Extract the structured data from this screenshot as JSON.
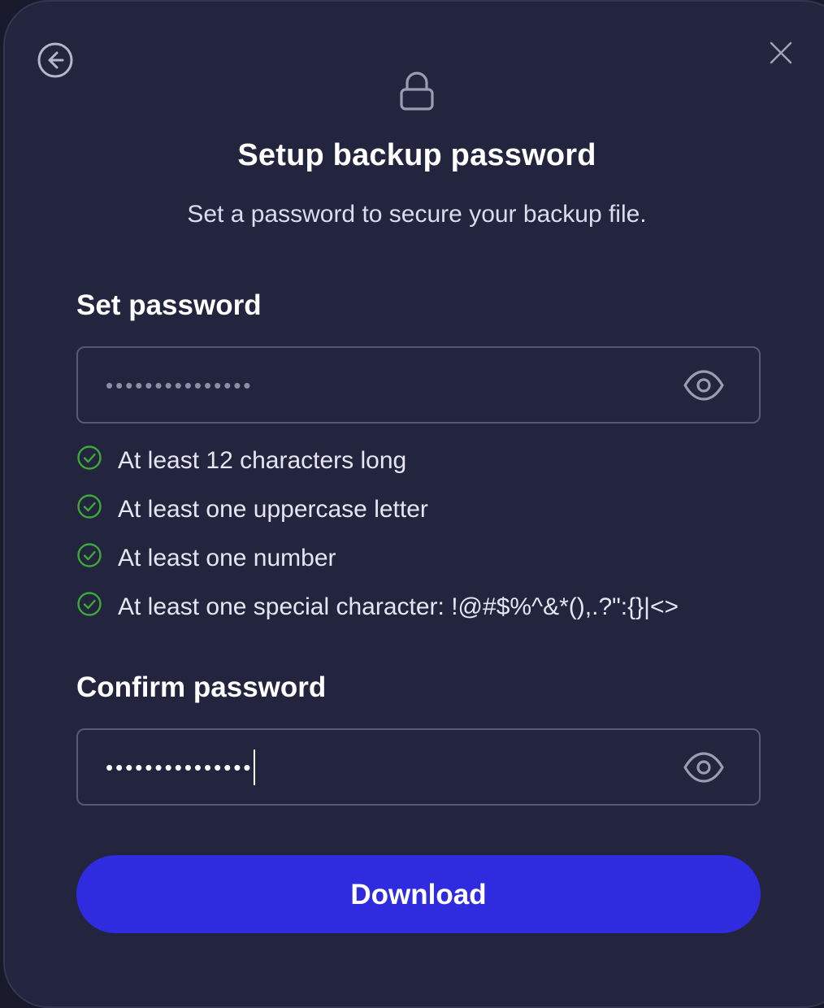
{
  "dialog": {
    "title": "Setup backup password",
    "subtitle": "Set a password to secure your backup file."
  },
  "set_password": {
    "label": "Set password",
    "masked_value": "•••••••••••••••",
    "visibility_icon": "eye-icon"
  },
  "requirements": [
    {
      "text": "At least 12 characters long",
      "status": "met"
    },
    {
      "text": "At least one uppercase letter",
      "status": "met"
    },
    {
      "text": "At least one number",
      "status": "met"
    },
    {
      "text": "At least one special character: !@#$%^&*(),.?\":{}|<>",
      "status": "met"
    }
  ],
  "confirm_password": {
    "label": "Confirm password",
    "masked_value": "•••••••••••••••",
    "visibility_icon": "eye-icon"
  },
  "actions": {
    "download_label": "Download"
  },
  "icons": {
    "back": "back-arrow-circle-icon",
    "close": "close-icon",
    "lock": "lock-icon",
    "check": "check-circle-icon"
  },
  "colors": {
    "background": "#23243d",
    "primary_button": "#2f2bde",
    "check_green": "#3ea83a",
    "field_border": "#585a72",
    "muted_icon": "#9a9cb2"
  }
}
